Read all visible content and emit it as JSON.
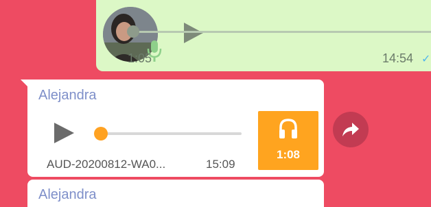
{
  "outgoing_voice": {
    "duration": "1:05",
    "time": "14:54",
    "status_icon": "read-tick-icon",
    "progress": 0
  },
  "incoming_voice": {
    "sender": "Alejandra",
    "file_name": "AUD-20200812-WA0...",
    "time": "15:09",
    "duration": "1:08",
    "progress": 0,
    "accent_color": "#ffa41f"
  },
  "next_message": {
    "sender": "Alejandra"
  },
  "colors": {
    "background": "#ee4b62",
    "outgoing_bubble": "#dcf8c6",
    "incoming_bubble": "#ffffff",
    "sender_name": "#7e8fc9"
  }
}
